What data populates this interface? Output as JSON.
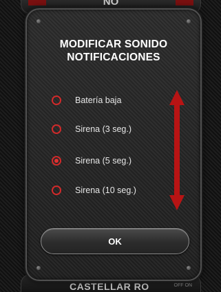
{
  "background": {
    "top_label": "NO",
    "bottom_label": "CASTELLAR RO",
    "bottom_small": "OFF ON"
  },
  "dialog": {
    "title_line1": "MODIFICAR SONIDO",
    "title_line2": "NOTIFICACIONES",
    "options": [
      {
        "label": "Batería baja",
        "selected": false
      },
      {
        "label": "Sirena (3 seg.)",
        "selected": false
      },
      {
        "label": "Sirena (5 seg.)",
        "selected": true
      },
      {
        "label": "Sirena (10 seg.)",
        "selected": false
      }
    ],
    "ok_label": "OK"
  },
  "colors": {
    "accent": "#d12a2a",
    "arrow": "#b81414",
    "text": "#ffffff"
  },
  "icons": {
    "scroll": "double-arrow-vertical-icon",
    "radio": "radio-button-icon"
  }
}
